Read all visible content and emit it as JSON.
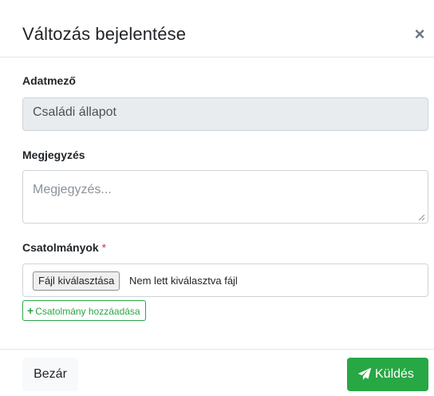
{
  "modal": {
    "title": "Változás bejelentése",
    "close_symbol": "×"
  },
  "fields": {
    "adatmezo": {
      "label": "Adatmező",
      "value": "Családi állapot"
    },
    "megjegyzes": {
      "label": "Megjegyzés",
      "placeholder": "Megjegyzés...",
      "value": ""
    },
    "csatolmanyok": {
      "label": "Csatolmányok",
      "required_marker": "*",
      "file_button": "Fájl kiválasztása",
      "file_status": "Nem lett kiválasztva fájl",
      "add_button": "Csatolmány hozzáadása",
      "add_icon": "plus-icon"
    }
  },
  "footer": {
    "close_button": "Bezár",
    "send_button": "Küldés",
    "send_icon": "paper-plane-icon"
  },
  "colors": {
    "success": "#28a745",
    "required": "#dc3545",
    "readonly_bg": "#e9ecef"
  }
}
